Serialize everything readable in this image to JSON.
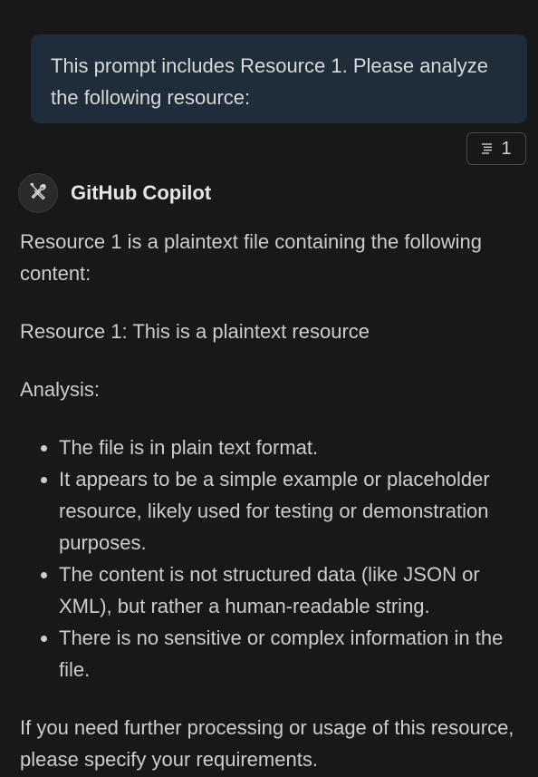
{
  "user_message": {
    "text": "This prompt includes Resource 1. Please analyze the following resource:"
  },
  "reference_badge": {
    "icon": "list-lines-icon",
    "count": "1"
  },
  "assistant": {
    "name": "GitHub Copilot",
    "avatar_icon": "tools-icon"
  },
  "response": {
    "intro": "Resource 1 is a plaintext file containing the following content:",
    "resource_line": "Resource 1: This is a plaintext resource",
    "analysis_heading": "Analysis:",
    "bullets": [
      "The file is in plain text format.",
      "It appears to be a simple example or placeholder resource, likely used for testing or demonstration purposes.",
      "The content is not structured data (like JSON or XML), but rather a human-readable string.",
      "There is no sensitive or complex information in the file."
    ],
    "closing": "If you need further processing or usage of this resource, please specify your requirements."
  }
}
